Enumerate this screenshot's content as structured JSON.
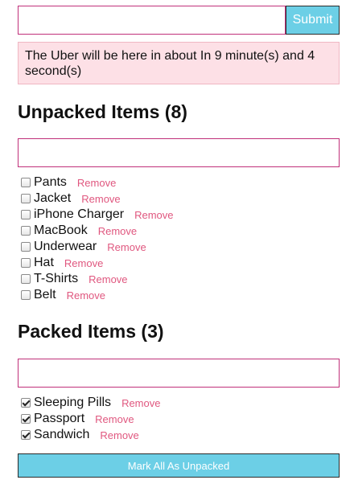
{
  "new_item": {
    "value": "",
    "submit_label": "Submit"
  },
  "alert": {
    "message": "The Uber will be here in about In 9 minute(s) and 4 second(s)"
  },
  "unpacked": {
    "heading": "Unpacked Items (8)",
    "filter_value": "",
    "items": [
      {
        "name": "Pants",
        "remove_label": "Remove",
        "checked": false
      },
      {
        "name": "Jacket",
        "remove_label": "Remove",
        "checked": false
      },
      {
        "name": "iPhone Charger",
        "remove_label": "Remove",
        "checked": false
      },
      {
        "name": "MacBook",
        "remove_label": "Remove",
        "checked": false
      },
      {
        "name": "Underwear",
        "remove_label": "Remove",
        "checked": false
      },
      {
        "name": "Hat",
        "remove_label": "Remove",
        "checked": false
      },
      {
        "name": "T-Shirts",
        "remove_label": "Remove",
        "checked": false
      },
      {
        "name": "Belt",
        "remove_label": "Remove",
        "checked": false
      }
    ]
  },
  "packed": {
    "heading": "Packed Items (3)",
    "filter_value": "",
    "items": [
      {
        "name": "Sleeping Pills",
        "remove_label": "Remove",
        "checked": true
      },
      {
        "name": "Passport",
        "remove_label": "Remove",
        "checked": true
      },
      {
        "name": "Sandwich",
        "remove_label": "Remove",
        "checked": true
      }
    ]
  },
  "mark_all_label": "Mark All As Unpacked",
  "colors": {
    "accent_button": "#6ccfe6",
    "input_border": "#c0307a",
    "alert_background": "#fde0e6",
    "remove_link": "#e0577f"
  }
}
